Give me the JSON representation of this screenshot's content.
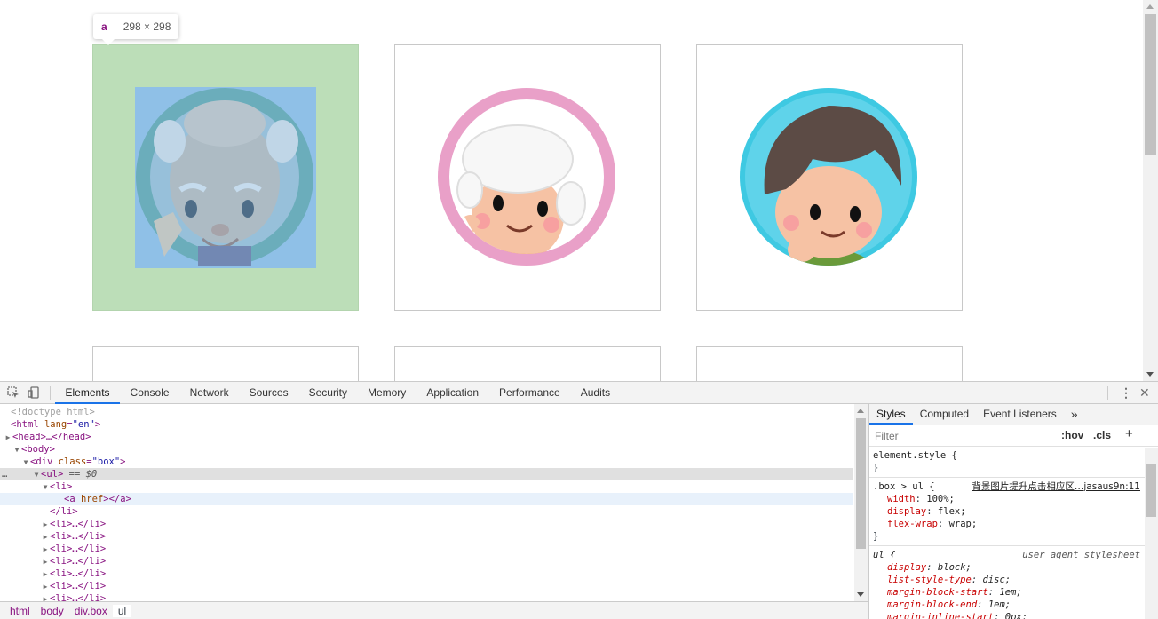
{
  "page": {
    "tooltip": {
      "tag": "a",
      "dims": "298 × 298"
    },
    "cards": [
      {
        "name": "old-man-avatar",
        "state": "highlighted"
      },
      {
        "name": "grandmother-avatar",
        "state": "normal"
      },
      {
        "name": "boy-avatar",
        "state": "normal"
      }
    ],
    "colors": {
      "highlight_margin": "#bcdeb8",
      "highlight_content": "#8fc0e7",
      "pink_ring": "#e9a0c8",
      "blue_ring": "#3ec9e2",
      "teal_ring": "#6bb8b2"
    }
  },
  "devtools": {
    "tabs": [
      "Elements",
      "Console",
      "Network",
      "Sources",
      "Security",
      "Memory",
      "Application",
      "Performance",
      "Audits"
    ],
    "active_tab": "Elements",
    "dom": {
      "doctype": "<!doctype html>",
      "html_tag": "html",
      "html_attr": "lang",
      "html_val": "\"en\"",
      "head_collapsed": "<head>…</head>",
      "body_open": "<body>",
      "div_tag": "div",
      "div_attr": "class",
      "div_val": "\"box\"",
      "ul_open": "<ul>",
      "ul_marker": "== $0",
      "li_open": "<li>",
      "a_tag": "a",
      "a_attr": "href",
      "a_close": "</a>",
      "li_close": "</li>",
      "li_collapsed": "<li>…</li>"
    },
    "breadcrumb": [
      "html",
      "body",
      "div.box",
      "ul"
    ],
    "styles": {
      "tabs": [
        "Styles",
        "Computed",
        "Event Listeners"
      ],
      "more": "»",
      "filter_placeholder": "Filter",
      "hov": ":hov",
      "cls": ".cls",
      "plus": "+",
      "element_style": "element.style {",
      "close_brace": "}",
      "rule1_selector": ".box > ul {",
      "rule1_source": "背景图片提升点击相应区…jasaus9n:11",
      "rule1_props": [
        {
          "name": "width",
          "value": "100%;"
        },
        {
          "name": "display",
          "value": "flex;"
        },
        {
          "name": "flex-wrap",
          "value": "wrap;"
        }
      ],
      "rule2_selector": "ul {",
      "rule2_source": "user agent stylesheet",
      "rule2_props": [
        {
          "name": "display",
          "value": "block;",
          "struck": true
        },
        {
          "name": "list-style-type",
          "value": "disc;"
        },
        {
          "name": "margin-block-start",
          "value": "1em;"
        },
        {
          "name": "margin-block-end",
          "value": "1em;"
        },
        {
          "name": "margin-inline-start",
          "value": "0px;"
        }
      ]
    }
  }
}
